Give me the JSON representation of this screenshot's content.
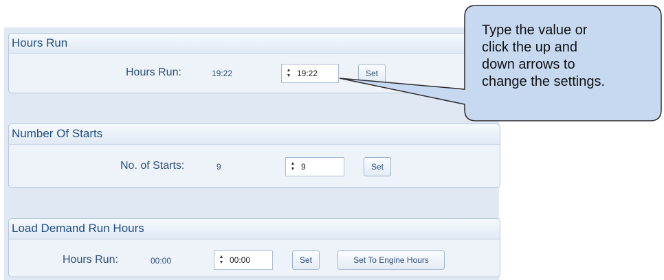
{
  "hours_run": {
    "title": "Hours Run",
    "label": "Hours Run:",
    "current_value": "19:22",
    "spinner_value": "19:22",
    "set_label": "Set"
  },
  "number_of_starts": {
    "title": "Number Of Starts",
    "label": "No. of Starts:",
    "current_value": "9",
    "spinner_value": "9",
    "set_label": "Set"
  },
  "load_demand": {
    "title": "Load Demand Run Hours",
    "label": "Hours Run:",
    "current_value": "00:00",
    "spinner_value": "00:00",
    "set_label": "Set",
    "set_engine_label": "Set To Engine Hours"
  },
  "callout": {
    "line1": "Type the value or",
    "line2": "click the up and",
    "line3": "down arrows to",
    "line4": "change the settings."
  },
  "colors": {
    "panel_bg": "#dfe8f3",
    "group_bg": "#eef3f9",
    "header_text": "#1f4f86",
    "callout_fill": "#c6d9f1"
  }
}
